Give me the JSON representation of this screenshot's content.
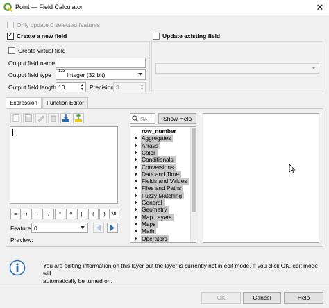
{
  "window": {
    "title": "Point — Field Calculator",
    "close_glyph": "✕"
  },
  "only_update_selected": {
    "label": "Only update 0 selected features",
    "checked": false,
    "enabled": false
  },
  "create_new_field": {
    "label": "Create a new field",
    "checked": true,
    "create_virtual": {
      "label": "Create virtual field",
      "checked": false
    },
    "output_name": {
      "label": "Output field name",
      "value": ""
    },
    "output_type": {
      "label": "Output field type",
      "type_badge": "123",
      "value": "Integer (32 bit)"
    },
    "output_length": {
      "label": "Output field length",
      "value": "10"
    },
    "precision": {
      "label": "Precision",
      "value": "3"
    }
  },
  "update_existing_field": {
    "label": "Update existing field",
    "checked": false,
    "selected_field": ""
  },
  "tabs": [
    {
      "label": "Expression",
      "active": true
    },
    {
      "label": "Function Editor",
      "active": false
    }
  ],
  "toolbar_icons": [
    "new-file-icon",
    "save-icon",
    "edit-icon",
    "delete-icon",
    "import-icon",
    "export-icon"
  ],
  "operators": [
    "=",
    "+",
    "-",
    "/",
    "*",
    "^",
    "||",
    "(",
    ")",
    "'\\n'"
  ],
  "feature": {
    "label": "Feature",
    "value": "0"
  },
  "preview": {
    "label": "Preview:",
    "value": ""
  },
  "search": {
    "placeholder": "Se...",
    "show_help": "Show Help"
  },
  "function_list": [
    {
      "label": "row_number",
      "expandable": false,
      "bold": true
    },
    {
      "label": "Aggregates",
      "expandable": true
    },
    {
      "label": "Arrays",
      "expandable": true
    },
    {
      "label": "Color",
      "expandable": true
    },
    {
      "label": "Conditionals",
      "expandable": true
    },
    {
      "label": "Conversions",
      "expandable": true
    },
    {
      "label": "Date and Time",
      "expandable": true
    },
    {
      "label": "Fields and Values",
      "expandable": true
    },
    {
      "label": "Files and Paths",
      "expandable": true
    },
    {
      "label": "Fuzzy Matching",
      "expandable": true
    },
    {
      "label": "General",
      "expandable": true
    },
    {
      "label": "Geometry",
      "expandable": true
    },
    {
      "label": "Map Layers",
      "expandable": true
    },
    {
      "label": "Maps",
      "expandable": true
    },
    {
      "label": "Math",
      "expandable": true
    },
    {
      "label": "Operators",
      "expandable": true
    }
  ],
  "info_message": {
    "line1": "You are editing information on this layer but the layer is currently not in edit mode. If you click OK, edit mode will",
    "line2": "automatically be turned on."
  },
  "buttons": {
    "ok": "OK",
    "cancel": "Cancel",
    "help": "Help"
  },
  "colors": {
    "accent_blue": "#2a6ebb",
    "qgis_green": "#589632",
    "qgis_yellow": "#eec90d",
    "list_highlight": "#c8c8c8"
  }
}
